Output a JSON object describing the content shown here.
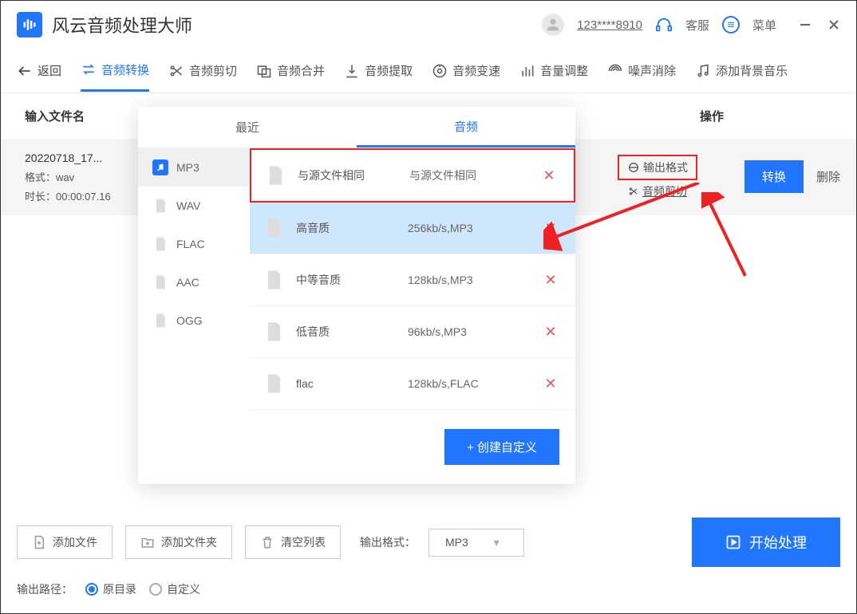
{
  "app_title": "风云音频处理大师",
  "user_id": "123****8910",
  "kefu": "客服",
  "menu": "菜单",
  "toolbar": {
    "back": "返回",
    "items": [
      "音频转换",
      "音频剪切",
      "音频合并",
      "音频提取",
      "音频变速",
      "音量调整",
      "噪声消除",
      "添加背景音乐"
    ]
  },
  "columns": {
    "filename": "输入文件名",
    "actions": "操作"
  },
  "file": {
    "name": "20220718_17...",
    "format_label": "格式：",
    "format": "wav",
    "duration_label": "时长：",
    "duration": "00:00:07.16"
  },
  "row_actions": {
    "output_format": "输出格式",
    "trim": "音频剪切",
    "convert": "转换",
    "delete": "删除"
  },
  "popup": {
    "tabs": {
      "recent": "最近",
      "audio": "音频"
    },
    "formats": [
      "MP3",
      "WAV",
      "FLAC",
      "AAC",
      "OGG"
    ],
    "quality": [
      {
        "name": "与源文件相同",
        "spec": "与源文件相同"
      },
      {
        "name": "高音质",
        "spec": "256kb/s,MP3"
      },
      {
        "name": "中等音质",
        "spec": "128kb/s,MP3"
      },
      {
        "name": "低音质",
        "spec": "96kb/s,MP3"
      },
      {
        "name": "flac",
        "spec": "128kb/s,FLAC"
      }
    ],
    "create_custom": "+  创建自定义"
  },
  "bottom": {
    "add_file": "添加文件",
    "add_folder": "添加文件夹",
    "clear_list": "清空列表",
    "output_format_label": "输出格式：",
    "output_format_value": "MP3",
    "start": "开始处理",
    "output_path_label": "输出路径：",
    "radio_original": "原目录",
    "radio_custom": "自定义"
  }
}
